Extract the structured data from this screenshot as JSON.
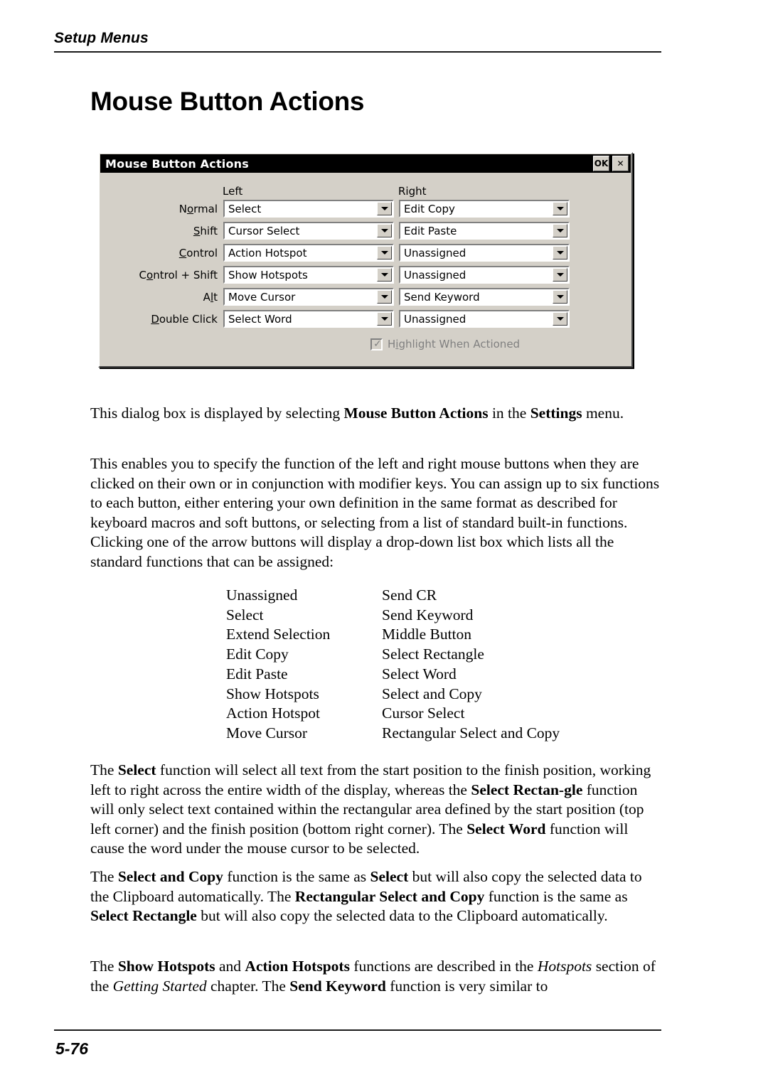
{
  "header": {
    "running_title": "Setup Menus"
  },
  "page_heading": "Mouse Button Actions",
  "dialog": {
    "title": "Mouse Button Actions",
    "ok_button": "OK",
    "close_button": "✕",
    "column_headers": {
      "left": "Left",
      "right": "Right"
    },
    "rows": [
      {
        "label_pre": "N",
        "label_accel": "o",
        "label_post": "rmal",
        "left": "Select",
        "right": "Edit Copy"
      },
      {
        "label_pre": "",
        "label_accel": "S",
        "label_post": "hift",
        "left": "Cursor Select",
        "right": "Edit Paste"
      },
      {
        "label_pre": "",
        "label_accel": "C",
        "label_post": "ontrol",
        "left": "Action Hotspot",
        "right": "Unassigned"
      },
      {
        "label_pre": "C",
        "label_accel": "o",
        "label_post": "ntrol + Shift",
        "left": "Show Hotspots",
        "right": "Unassigned"
      },
      {
        "label_pre": "A",
        "label_accel": "l",
        "label_post": "t",
        "left": "Move Cursor",
        "right": "Send Keyword"
      },
      {
        "label_pre": "",
        "label_accel": "D",
        "label_post": "ouble Click",
        "left": "Select Word",
        "right": "Unassigned"
      }
    ],
    "checkbox": {
      "label_pre": "H",
      "label_accel": "i",
      "label_post": "ghlight When Actioned",
      "checked": true,
      "enabled": false,
      "tick_glyph": "✓"
    },
    "colors": {
      "face": "#d4d0c8",
      "titlebar": "#000000",
      "titlebar_text": "#ffffff",
      "disabled_text": "#808080",
      "field": "#ffffff"
    }
  },
  "paragraphs": {
    "p1_a": "This dialog box is displayed by selecting ",
    "p1_b1": "Mouse Button Actions",
    "p1_c": " in the ",
    "p1_b2": "Settings",
    "p1_d": " menu.",
    "p2": "This enables you to specify the function of the left and right mouse buttons when they are clicked on their own or in conjunction with modifier keys. You can assign up to six functions to each button, either entering your own definition in the same format as described for keyboard macros and soft buttons, or selecting from a list of standard built-in functions. Clicking one of the arrow buttons will display a drop-down list box which lists all the standard functions that can be assigned:",
    "p4_a": "The ",
    "p4_b1": "Select",
    "p4_c": " function will select all text from the start position to the finish position, working left to right across the entire width of the display, whereas the ",
    "p4_b2": "Select Rectan-gle",
    "p4_d": " function will only select text contained within the rectangular area defined by the start position (top left corner) and the finish position (bottom right corner). The ",
    "p4_b3": "Select Word",
    "p4_e": " function will cause the word under the mouse cursor to be selected.",
    "p5_a": "The ",
    "p5_b1": "Select and Copy",
    "p5_c": " function is the same as ",
    "p5_b2": "Select",
    "p5_d": " but will also copy the selected data to the Clipboard automatically. The ",
    "p5_b3": "Rectangular Select and Copy",
    "p5_e": " function is the same as ",
    "p5_b4": "Select Rectangle",
    "p5_f": " but will also copy the selected data to the Clipboard automatically.",
    "p6_a": "The ",
    "p6_b1": "Show Hotspots",
    "p6_c": " and ",
    "p6_b2": "Action Hotspots",
    "p6_d": " functions are described in the ",
    "p6_i1": "Hotspots",
    "p6_e": " section of the ",
    "p6_i2": "Getting Started",
    "p6_f": " chapter. The ",
    "p6_b3": "Send Keyword",
    "p6_g": " function is very similar to"
  },
  "function_list": {
    "rows": [
      {
        "a": "Unassigned",
        "b": "Send CR"
      },
      {
        "a": "Select",
        "b": "Send Keyword"
      },
      {
        "a": "Extend Selection",
        "b": "Middle Button"
      },
      {
        "a": "Edit Copy",
        "b": "Select Rectangle"
      },
      {
        "a": "Edit Paste",
        "b": "Select Word"
      },
      {
        "a": "Show Hotspots",
        "b": "Select and Copy"
      },
      {
        "a": "Action Hotspot",
        "b": "Cursor Select"
      },
      {
        "a": "Move Cursor",
        "b": "Rectangular Select and Copy"
      }
    ]
  },
  "footer": {
    "page_number": "5-76"
  }
}
